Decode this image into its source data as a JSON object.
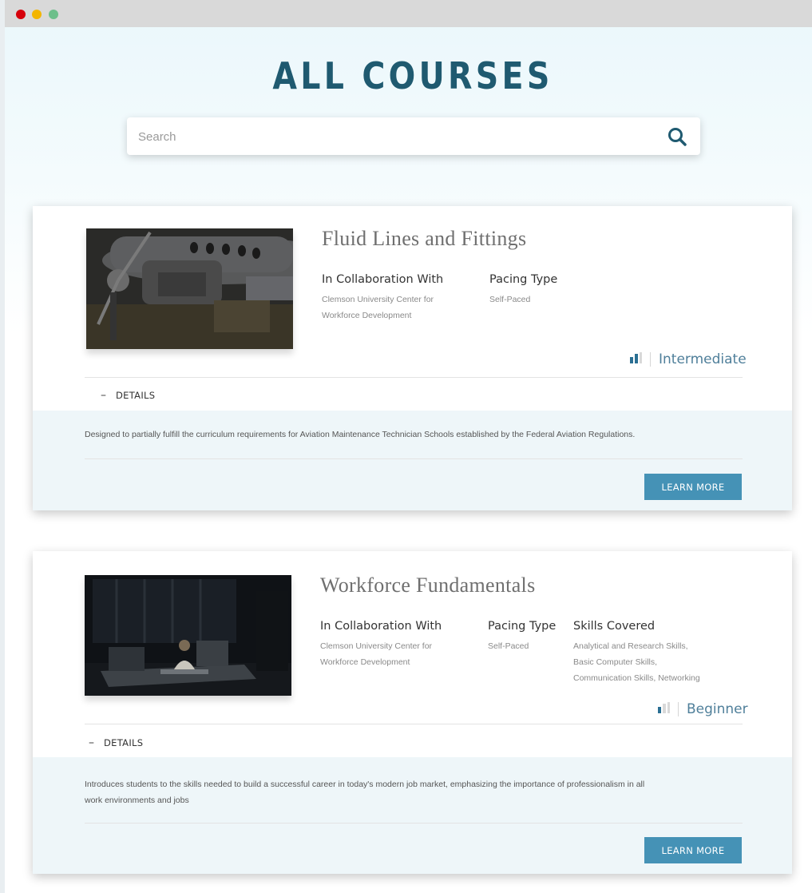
{
  "window": {
    "controls": [
      "close",
      "minimize",
      "maximize"
    ]
  },
  "page": {
    "title": "ALL COURSES"
  },
  "search": {
    "placeholder": "Search",
    "value": "",
    "icon": "search-icon"
  },
  "courses": [
    {
      "title": "Fluid Lines and Fittings",
      "image": "aircraft-engine-photo",
      "collaboration_heading": "In Collaboration With",
      "collaboration_value_line1": "Clemson University Center for",
      "collaboration_value_line2": "Workforce Development",
      "pacing_heading": "Pacing Type",
      "pacing_value": "Self-Paced",
      "level": "Intermediate",
      "level_icon": "bar-level-icon",
      "details_toggle": "–",
      "details_label": "DETAILS",
      "description": "Designed to partially fulfill the curriculum requirements for Aviation Maintenance Technician Schools established by the Federal Aviation Regulations.",
      "learn_more": "LEARN MORE"
    },
    {
      "title": "Workforce Fundamentals",
      "image": "office-worker-photo",
      "collaboration_heading": "In Collaboration With",
      "collaboration_value_line1": "Clemson University Center for",
      "collaboration_value_line2": "Workforce Development",
      "pacing_heading": "Pacing Type",
      "pacing_value": "Self-Paced",
      "skills_heading": "Skills Covered",
      "skills_value_line1": "Analytical and Research Skills,",
      "skills_value_line2": "Basic Computer Skills,",
      "skills_value_line3": "Communication Skills, Networking",
      "level": "Beginner",
      "level_icon": "bar-level-icon",
      "details_toggle": "–",
      "details_label": "DETAILS",
      "description_line1": "Introduces students to the skills needed to build a successful career in today's modern job market, emphasizing the importance of professionalism in all",
      "description_line2": "work environments and jobs",
      "learn_more": "LEARN MORE"
    }
  ],
  "colors": {
    "title": "#1f5a70",
    "accent_button": "#4592b6",
    "level_text": "#4f7f9a",
    "details_panel_bg": "#eef6f9"
  }
}
